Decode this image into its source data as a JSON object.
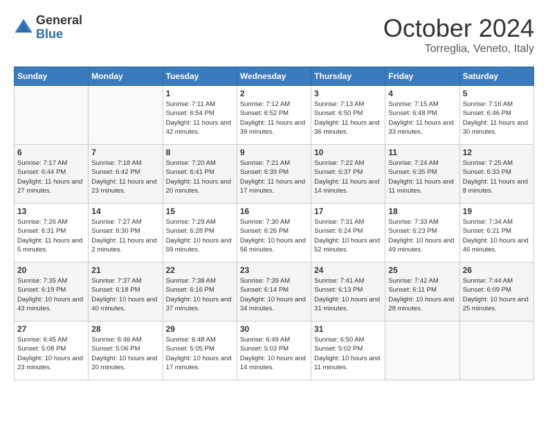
{
  "header": {
    "logo_general": "General",
    "logo_blue": "Blue",
    "month_title": "October 2024",
    "location": "Torreglia, Veneto, Italy"
  },
  "calendar": {
    "days_of_week": [
      "Sunday",
      "Monday",
      "Tuesday",
      "Wednesday",
      "Thursday",
      "Friday",
      "Saturday"
    ],
    "weeks": [
      [
        {
          "day": "",
          "sunrise": "",
          "sunset": "",
          "daylight": ""
        },
        {
          "day": "",
          "sunrise": "",
          "sunset": "",
          "daylight": ""
        },
        {
          "day": "1",
          "sunrise": "Sunrise: 7:11 AM",
          "sunset": "Sunset: 6:54 PM",
          "daylight": "Daylight: 11 hours and 42 minutes."
        },
        {
          "day": "2",
          "sunrise": "Sunrise: 7:12 AM",
          "sunset": "Sunset: 6:52 PM",
          "daylight": "Daylight: 11 hours and 39 minutes."
        },
        {
          "day": "3",
          "sunrise": "Sunrise: 7:13 AM",
          "sunset": "Sunset: 6:50 PM",
          "daylight": "Daylight: 11 hours and 36 minutes."
        },
        {
          "day": "4",
          "sunrise": "Sunrise: 7:15 AM",
          "sunset": "Sunset: 6:48 PM",
          "daylight": "Daylight: 11 hours and 33 minutes."
        },
        {
          "day": "5",
          "sunrise": "Sunrise: 7:16 AM",
          "sunset": "Sunset: 6:46 PM",
          "daylight": "Daylight: 11 hours and 30 minutes."
        }
      ],
      [
        {
          "day": "6",
          "sunrise": "Sunrise: 7:17 AM",
          "sunset": "Sunset: 6:44 PM",
          "daylight": "Daylight: 11 hours and 27 minutes."
        },
        {
          "day": "7",
          "sunrise": "Sunrise: 7:18 AM",
          "sunset": "Sunset: 6:42 PM",
          "daylight": "Daylight: 11 hours and 23 minutes."
        },
        {
          "day": "8",
          "sunrise": "Sunrise: 7:20 AM",
          "sunset": "Sunset: 6:41 PM",
          "daylight": "Daylight: 11 hours and 20 minutes."
        },
        {
          "day": "9",
          "sunrise": "Sunrise: 7:21 AM",
          "sunset": "Sunset: 6:39 PM",
          "daylight": "Daylight: 11 hours and 17 minutes."
        },
        {
          "day": "10",
          "sunrise": "Sunrise: 7:22 AM",
          "sunset": "Sunset: 6:37 PM",
          "daylight": "Daylight: 11 hours and 14 minutes."
        },
        {
          "day": "11",
          "sunrise": "Sunrise: 7:24 AM",
          "sunset": "Sunset: 6:35 PM",
          "daylight": "Daylight: 11 hours and 11 minutes."
        },
        {
          "day": "12",
          "sunrise": "Sunrise: 7:25 AM",
          "sunset": "Sunset: 6:33 PM",
          "daylight": "Daylight: 11 hours and 8 minutes."
        }
      ],
      [
        {
          "day": "13",
          "sunrise": "Sunrise: 7:26 AM",
          "sunset": "Sunset: 6:31 PM",
          "daylight": "Daylight: 11 hours and 5 minutes."
        },
        {
          "day": "14",
          "sunrise": "Sunrise: 7:27 AM",
          "sunset": "Sunset: 6:30 PM",
          "daylight": "Daylight: 11 hours and 2 minutes."
        },
        {
          "day": "15",
          "sunrise": "Sunrise: 7:29 AM",
          "sunset": "Sunset: 6:28 PM",
          "daylight": "Daylight: 10 hours and 59 minutes."
        },
        {
          "day": "16",
          "sunrise": "Sunrise: 7:30 AM",
          "sunset": "Sunset: 6:26 PM",
          "daylight": "Daylight: 10 hours and 56 minutes."
        },
        {
          "day": "17",
          "sunrise": "Sunrise: 7:31 AM",
          "sunset": "Sunset: 6:24 PM",
          "daylight": "Daylight: 10 hours and 52 minutes."
        },
        {
          "day": "18",
          "sunrise": "Sunrise: 7:33 AM",
          "sunset": "Sunset: 6:23 PM",
          "daylight": "Daylight: 10 hours and 49 minutes."
        },
        {
          "day": "19",
          "sunrise": "Sunrise: 7:34 AM",
          "sunset": "Sunset: 6:21 PM",
          "daylight": "Daylight: 10 hours and 46 minutes."
        }
      ],
      [
        {
          "day": "20",
          "sunrise": "Sunrise: 7:35 AM",
          "sunset": "Sunset: 6:19 PM",
          "daylight": "Daylight: 10 hours and 43 minutes."
        },
        {
          "day": "21",
          "sunrise": "Sunrise: 7:37 AM",
          "sunset": "Sunset: 6:18 PM",
          "daylight": "Daylight: 10 hours and 40 minutes."
        },
        {
          "day": "22",
          "sunrise": "Sunrise: 7:38 AM",
          "sunset": "Sunset: 6:16 PM",
          "daylight": "Daylight: 10 hours and 37 minutes."
        },
        {
          "day": "23",
          "sunrise": "Sunrise: 7:39 AM",
          "sunset": "Sunset: 6:14 PM",
          "daylight": "Daylight: 10 hours and 34 minutes."
        },
        {
          "day": "24",
          "sunrise": "Sunrise: 7:41 AM",
          "sunset": "Sunset: 6:13 PM",
          "daylight": "Daylight: 10 hours and 31 minutes."
        },
        {
          "day": "25",
          "sunrise": "Sunrise: 7:42 AM",
          "sunset": "Sunset: 6:11 PM",
          "daylight": "Daylight: 10 hours and 28 minutes."
        },
        {
          "day": "26",
          "sunrise": "Sunrise: 7:44 AM",
          "sunset": "Sunset: 6:09 PM",
          "daylight": "Daylight: 10 hours and 25 minutes."
        }
      ],
      [
        {
          "day": "27",
          "sunrise": "Sunrise: 6:45 AM",
          "sunset": "Sunset: 5:08 PM",
          "daylight": "Daylight: 10 hours and 23 minutes."
        },
        {
          "day": "28",
          "sunrise": "Sunrise: 6:46 AM",
          "sunset": "Sunset: 5:06 PM",
          "daylight": "Daylight: 10 hours and 20 minutes."
        },
        {
          "day": "29",
          "sunrise": "Sunrise: 6:48 AM",
          "sunset": "Sunset: 5:05 PM",
          "daylight": "Daylight: 10 hours and 17 minutes."
        },
        {
          "day": "30",
          "sunrise": "Sunrise: 6:49 AM",
          "sunset": "Sunset: 5:03 PM",
          "daylight": "Daylight: 10 hours and 14 minutes."
        },
        {
          "day": "31",
          "sunrise": "Sunrise: 6:50 AM",
          "sunset": "Sunset: 5:02 PM",
          "daylight": "Daylight: 10 hours and 11 minutes."
        },
        {
          "day": "",
          "sunrise": "",
          "sunset": "",
          "daylight": ""
        },
        {
          "day": "",
          "sunrise": "",
          "sunset": "",
          "daylight": ""
        }
      ]
    ]
  }
}
